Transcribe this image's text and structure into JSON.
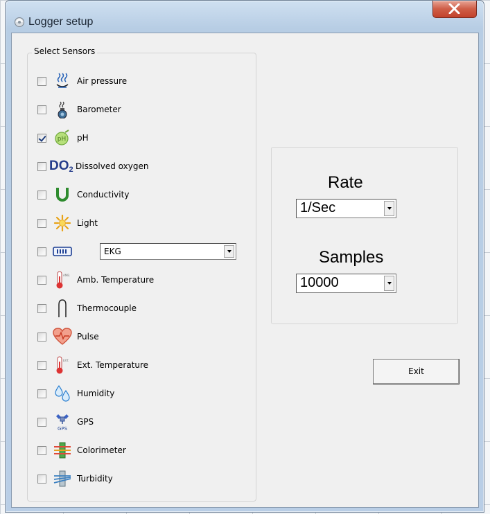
{
  "window": {
    "title": "Logger setup"
  },
  "sensors": {
    "group_label": "Select Sensors",
    "items": [
      {
        "label": "Air pressure",
        "checked": false,
        "icon": "air-pressure-icon"
      },
      {
        "label": "Barometer",
        "checked": false,
        "icon": "barometer-icon"
      },
      {
        "label": "pH",
        "checked": true,
        "icon": "ph-icon"
      },
      {
        "label": "Dissolved oxygen",
        "checked": false,
        "icon": "dissolved-oxygen-icon",
        "icon_text": "DO",
        "icon_subscript": "2"
      },
      {
        "label": "Conductivity",
        "checked": false,
        "icon": "conductivity-icon"
      },
      {
        "label": "Light",
        "checked": false,
        "icon": "light-icon"
      },
      {
        "label": "",
        "checked": false,
        "icon": "ekg-icon",
        "combo_value": "EKG"
      },
      {
        "label": "Amb. Temperature",
        "checked": false,
        "icon": "amb-temperature-icon",
        "icon_text": "AMB."
      },
      {
        "label": "Thermocouple",
        "checked": false,
        "icon": "thermocouple-icon"
      },
      {
        "label": "Pulse",
        "checked": false,
        "icon": "pulse-icon"
      },
      {
        "label": "Ext. Temperature",
        "checked": false,
        "icon": "ext-temperature-icon",
        "icon_text": "EXT."
      },
      {
        "label": "Humidity",
        "checked": false,
        "icon": "humidity-icon"
      },
      {
        "label": "GPS",
        "checked": false,
        "icon": "gps-icon",
        "icon_text": "GPS"
      },
      {
        "label": "Colorimeter",
        "checked": false,
        "icon": "colorimeter-icon"
      },
      {
        "label": "Turbidity",
        "checked": false,
        "icon": "turbidity-icon"
      }
    ]
  },
  "settings": {
    "rate_label": "Rate",
    "rate_value": "1/Sec",
    "samples_label": "Samples",
    "samples_value": "10000"
  },
  "buttons": {
    "exit_label": "Exit"
  }
}
